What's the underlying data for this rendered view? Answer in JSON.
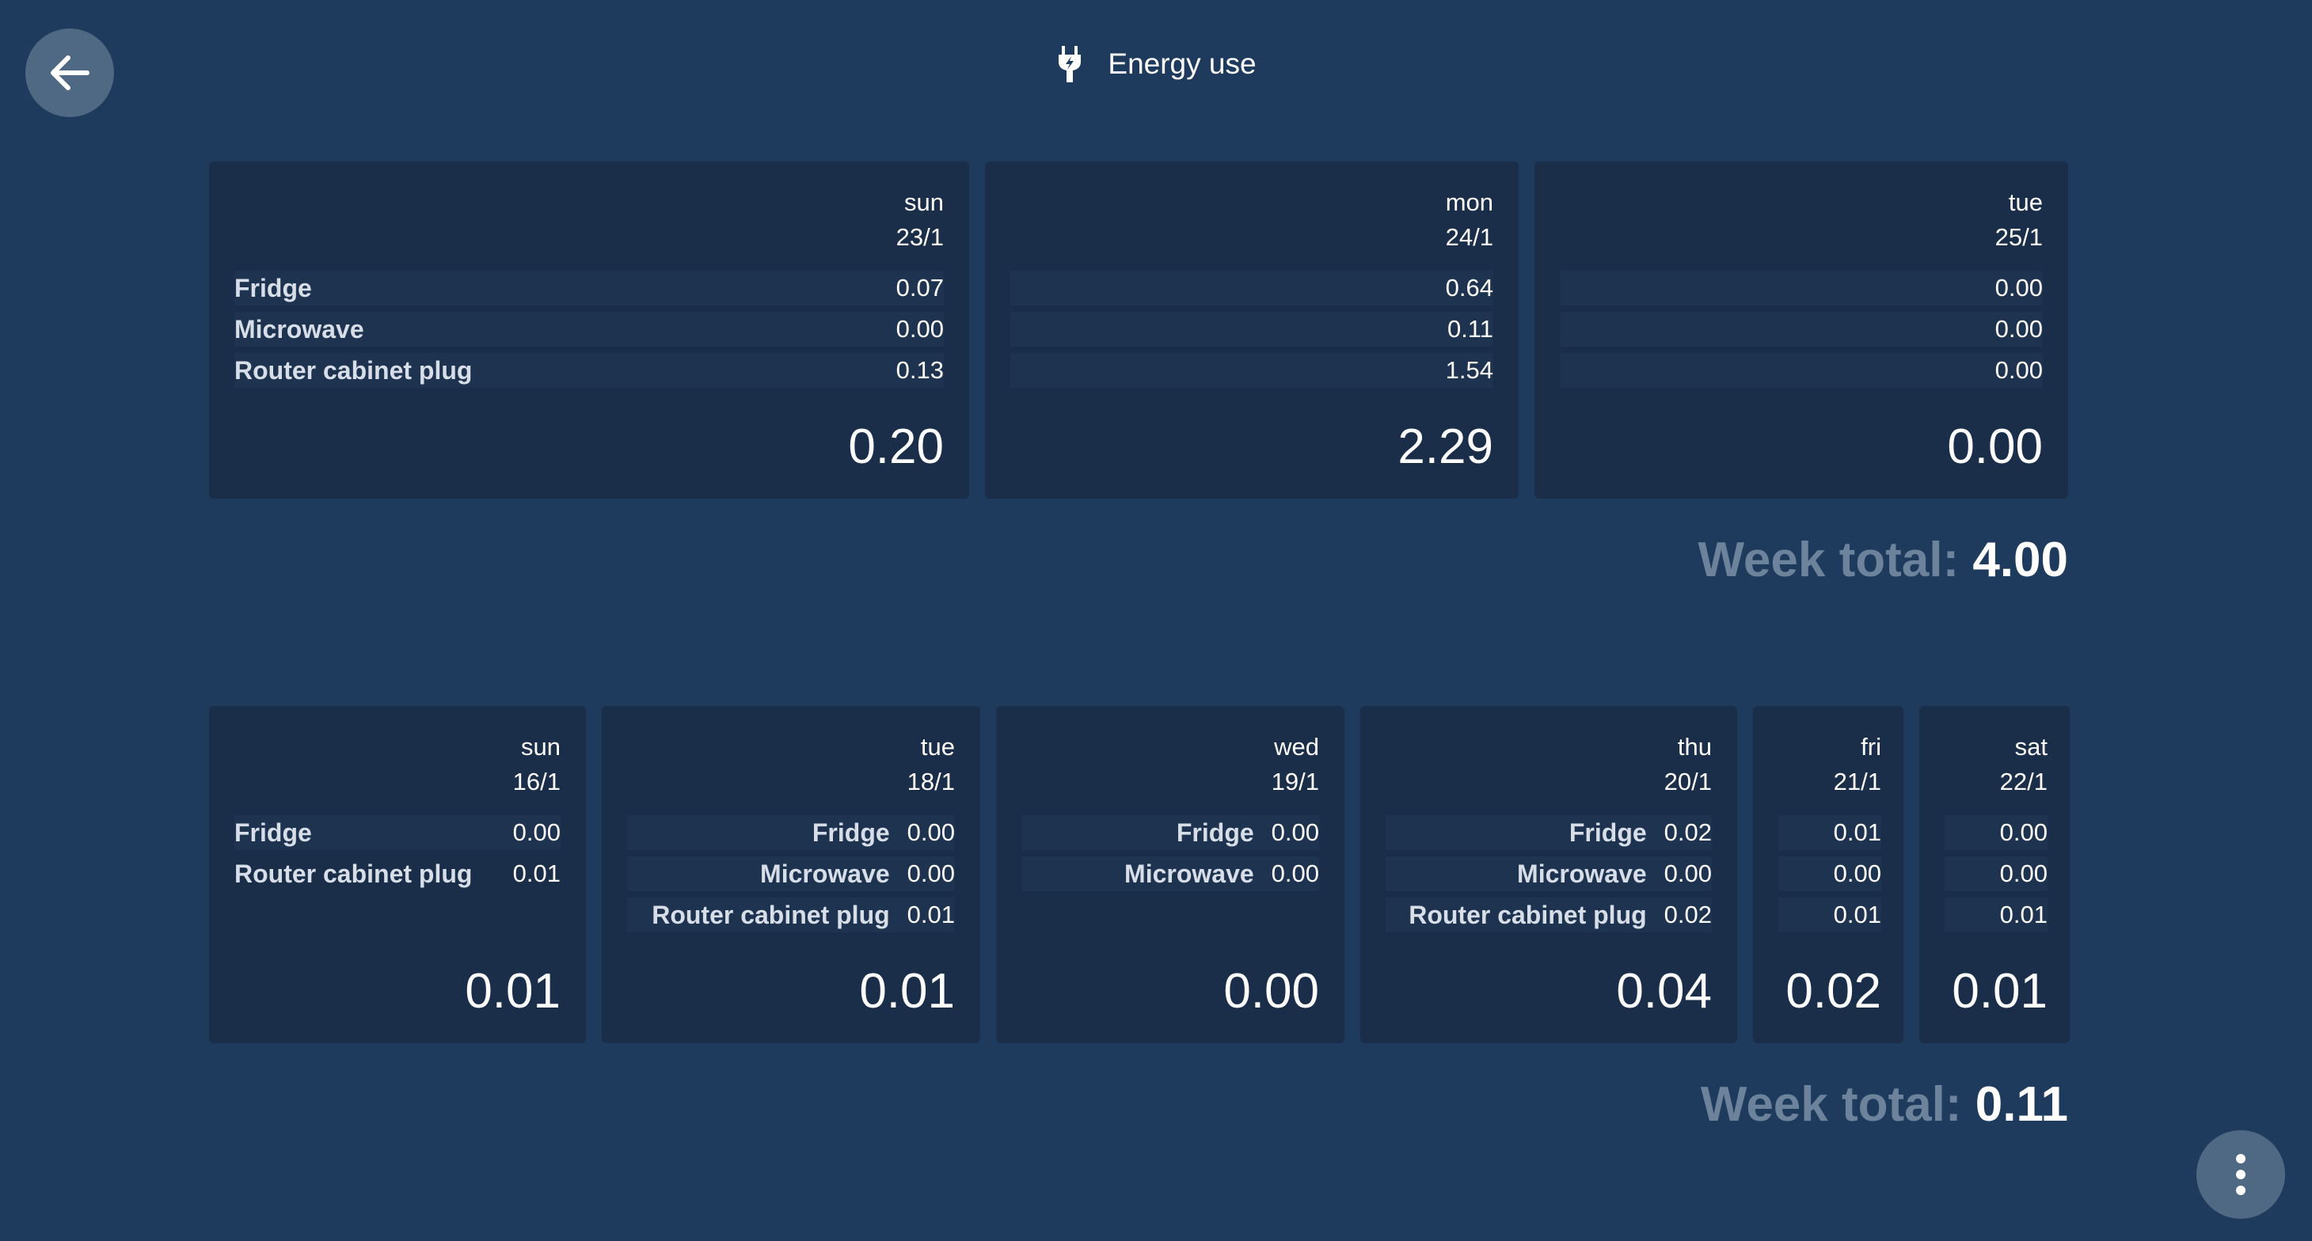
{
  "header": {
    "title": "Energy use"
  },
  "labels": {
    "week_total": "Week total:"
  },
  "icons": {
    "back": "arrow-left-icon",
    "plug": "plug-icon",
    "menu": "more-vertical-icon"
  },
  "current_week": {
    "days": [
      {
        "day": "sun",
        "date": "23/1",
        "rows": [
          {
            "name": "Fridge",
            "value": "0.07"
          },
          {
            "name": "Microwave",
            "value": "0.00"
          },
          {
            "name": "Router cabinet plug",
            "value": "0.13"
          }
        ],
        "total": "0.20"
      },
      {
        "day": "mon",
        "date": "24/1",
        "rows": [
          {
            "name": "",
            "value": "0.64"
          },
          {
            "name": "",
            "value": "0.11"
          },
          {
            "name": "",
            "value": "1.54"
          }
        ],
        "total": "2.29"
      },
      {
        "day": "tue",
        "date": "25/1",
        "rows": [
          {
            "name": "",
            "value": "0.00"
          },
          {
            "name": "",
            "value": "0.00"
          },
          {
            "name": "",
            "value": "0.00"
          }
        ],
        "total": "0.00"
      }
    ],
    "week_total": "4.00"
  },
  "previous_week": {
    "days": [
      {
        "day": "sun",
        "date": "16/1",
        "rows": [
          {
            "name": "Fridge",
            "value": "0.00"
          },
          {
            "name": "Router cabinet plug",
            "value": "0.01"
          }
        ],
        "total": "0.01"
      },
      {
        "day": "tue",
        "date": "18/1",
        "rows": [
          {
            "name": "Fridge",
            "value": "0.00"
          },
          {
            "name": "Microwave",
            "value": "0.00"
          },
          {
            "name": "Router cabinet plug",
            "value": "0.01"
          }
        ],
        "total": "0.01"
      },
      {
        "day": "wed",
        "date": "19/1",
        "rows": [
          {
            "name": "Fridge",
            "value": "0.00"
          },
          {
            "name": "Microwave",
            "value": "0.00"
          }
        ],
        "total": "0.00"
      },
      {
        "day": "thu",
        "date": "20/1",
        "rows": [
          {
            "name": "Fridge",
            "value": "0.02"
          },
          {
            "name": "Microwave",
            "value": "0.00"
          },
          {
            "name": "Router cabinet plug",
            "value": "0.02"
          }
        ],
        "total": "0.04"
      },
      {
        "day": "fri",
        "date": "21/1",
        "rows": [
          {
            "name": "",
            "value": "0.01"
          },
          {
            "name": "",
            "value": "0.00"
          },
          {
            "name": "",
            "value": "0.01"
          }
        ],
        "total": "0.02"
      },
      {
        "day": "sat",
        "date": "22/1",
        "rows": [
          {
            "name": "",
            "value": "0.00"
          },
          {
            "name": "",
            "value": "0.00"
          },
          {
            "name": "",
            "value": "0.01"
          }
        ],
        "total": "0.01"
      }
    ],
    "week_total": "0.11"
  }
}
